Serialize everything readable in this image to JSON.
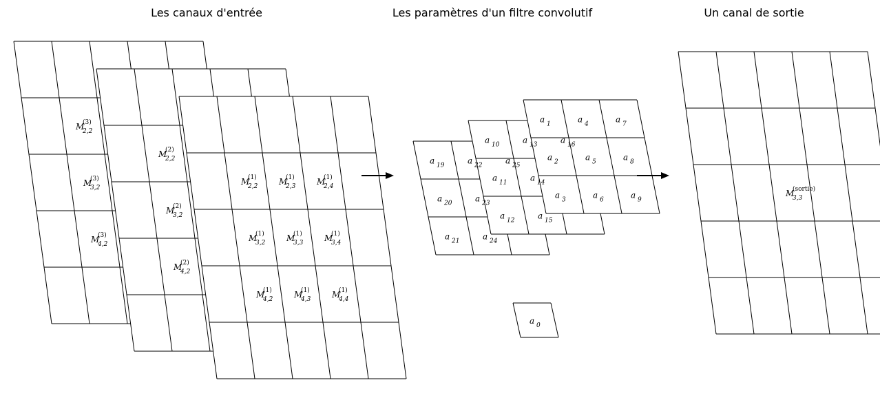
{
  "titles": {
    "input": "Les canaux d'entrée",
    "filter": "Les paramètres d'un filtre convolutif",
    "output": "Un canal de sortie"
  },
  "input_labels": {
    "front": [
      {
        "text": "M",
        "sub": "2,2",
        "sup": "(1)",
        "col": 0,
        "row": 0
      },
      {
        "text": "M",
        "sub": "2,3",
        "sup": "(1)",
        "col": 1,
        "row": 0
      },
      {
        "text": "M",
        "sub": "2,4",
        "sup": "(1)",
        "col": 2,
        "row": 0
      },
      {
        "text": "M",
        "sub": "3,2",
        "sup": "(1)",
        "col": 0,
        "row": 1
      },
      {
        "text": "M",
        "sub": "3,3",
        "sup": "(1)",
        "col": 1,
        "row": 1
      },
      {
        "text": "M",
        "sub": "3,4",
        "sup": "(1)",
        "col": 2,
        "row": 1
      },
      {
        "text": "M",
        "sub": "4,2",
        "sup": "(1)",
        "col": 0,
        "row": 2
      },
      {
        "text": "M",
        "sub": "4,3",
        "sup": "(1)",
        "col": 1,
        "row": 2
      },
      {
        "text": "M",
        "sub": "4,4",
        "sup": "(1)",
        "col": 2,
        "row": 2
      }
    ],
    "mid": [
      {
        "text": "M",
        "sub": "2,2",
        "sup": "(2)",
        "col": 0,
        "row": 0
      },
      {
        "text": "M",
        "sub": "3,2",
        "sup": "(2)",
        "col": 0,
        "row": 1
      },
      {
        "text": "M",
        "sub": "4,2",
        "sup": "(2)",
        "col": 0,
        "row": 2
      }
    ],
    "back": [
      {
        "text": "M",
        "sub": "2,2",
        "sup": "(3)",
        "col": 0,
        "row": 0
      },
      {
        "text": "M",
        "sub": "3,2",
        "sup": "(3)",
        "col": 0,
        "row": 1
      },
      {
        "text": "M",
        "sub": "4,2",
        "sup": "(3)",
        "col": 0,
        "row": 2
      }
    ]
  },
  "filter_labels": {
    "front": [
      {
        "text": "a",
        "sub": "1",
        "col": 2,
        "row": 0
      },
      {
        "text": "a",
        "sub": "2",
        "col": 2,
        "row": 1
      },
      {
        "text": "a",
        "sub": "3",
        "col": 2,
        "row": 2
      },
      {
        "text": "a",
        "sub": "4",
        "col": 3,
        "row": 0
      },
      {
        "text": "a",
        "sub": "5",
        "col": 3,
        "row": 1
      },
      {
        "text": "a",
        "sub": "6",
        "col": 3,
        "row": 2
      },
      {
        "text": "a",
        "sub": "7",
        "col": 4,
        "row": 0
      },
      {
        "text": "a",
        "sub": "8",
        "col": 4,
        "row": 1
      },
      {
        "text": "a",
        "sub": "9",
        "col": 4,
        "row": 2
      }
    ],
    "mid": [
      {
        "text": "a",
        "sub": "10",
        "col": 1,
        "row": 0
      },
      {
        "text": "a",
        "sub": "11",
        "col": 1,
        "row": 1
      },
      {
        "text": "a",
        "sub": "12",
        "col": 1,
        "row": 2
      },
      {
        "text": "a",
        "sub": "13",
        "col": 2,
        "row": 0
      },
      {
        "text": "a",
        "sub": "14",
        "col": 2,
        "row": 1
      },
      {
        "text": "a",
        "sub": "15",
        "col": 2,
        "row": 2
      },
      {
        "text": "a",
        "sub": "16",
        "col": 3,
        "row": 0
      }
    ],
    "back": [
      {
        "text": "a",
        "sub": "19",
        "col": 0,
        "row": 0
      },
      {
        "text": "a",
        "sub": "20",
        "col": 0,
        "row": 1
      },
      {
        "text": "a",
        "sub": "21",
        "col": 0,
        "row": 2
      },
      {
        "text": "a",
        "sub": "22",
        "col": 1,
        "row": 0
      },
      {
        "text": "a",
        "sub": "23",
        "col": 1,
        "row": 1
      },
      {
        "text": "a",
        "sub": "24",
        "col": 1,
        "row": 2
      },
      {
        "text": "a",
        "sub": "25",
        "col": 2,
        "row": 0
      }
    ]
  },
  "bias": {
    "text": "a",
    "sub": "0"
  },
  "output_label": {
    "text": "M",
    "sub": "3,3",
    "sup": "(sortie)"
  }
}
